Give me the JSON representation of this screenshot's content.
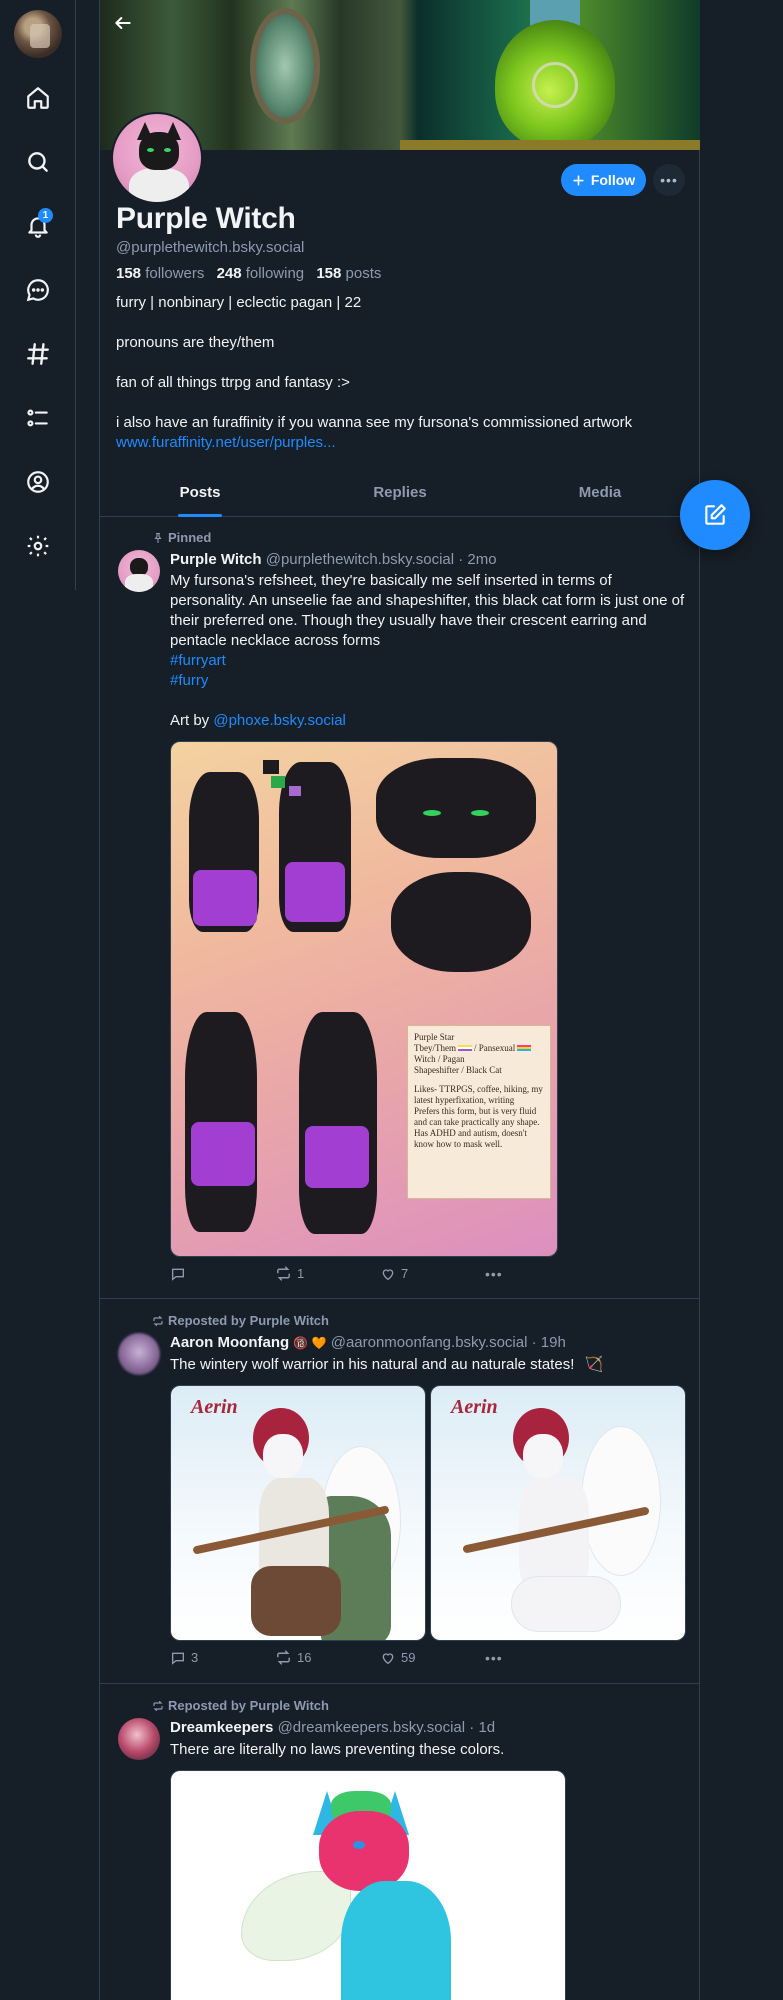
{
  "nav": {
    "items": [
      {
        "name": "home-icon"
      },
      {
        "name": "search-icon"
      },
      {
        "name": "notifications-icon",
        "badge": "1"
      },
      {
        "name": "chat-icon"
      },
      {
        "name": "feeds-icon"
      },
      {
        "name": "lists-icon"
      },
      {
        "name": "profile-icon"
      },
      {
        "name": "settings-icon"
      }
    ]
  },
  "profile": {
    "display_name": "Purple Witch",
    "handle": "@purplethewitch.bsky.social",
    "followers_count": "158",
    "followers_label": "followers",
    "following_count": "248",
    "following_label": "following",
    "posts_count": "158",
    "posts_label": "posts",
    "follow_label": "Follow",
    "bio": {
      "line1": "furry | nonbinary | eclectic pagan | 22",
      "line2": "pronouns are they/them",
      "line3": "fan of all things ttrpg and fantasy :>",
      "line4": "i also have an furaffinity if you wanna see my fursona's commissioned artwork",
      "link": "www.furaffinity.net/user/purples..."
    }
  },
  "tabs": [
    "Posts",
    "Replies",
    "Media"
  ],
  "posts": [
    {
      "context": "Pinned",
      "name": "Purple Witch",
      "handle": "@purplethewitch.bsky.social",
      "time": "· 2mo",
      "text": "My fursona's refsheet, they're basically me self inserted in terms of personality. An unseelie fae and shapeshifter, this black cat form is just one of their preferred one. Though they usually have their crescent earring and pentacle necklace across forms",
      "tag1": "#furryart",
      "tag2": "#furry",
      "art_prefix": "Art by",
      "art_mention": "@phoxe.bsky.social",
      "refcard": {
        "l1": "Purple Star",
        "l2": "Tbey/Them",
        "l2b": "/ Pansexual",
        "l3": "Witch / Pagan",
        "l4": "Shapeshifter / Black Cat",
        "l5": "Likes- TTRPGS, coffee, hiking, my latest hyperfixation, writing",
        "l6": "Prefers this form, but is very fluid and can take practically any shape.",
        "l7": "Has ADHD and autism, doesn't know how to mask well."
      },
      "replies": "",
      "reposts": "1",
      "likes": "7"
    },
    {
      "context": "Reposted by Purple Witch",
      "name": "Aaron Moonfang",
      "name_emoji": "🔞 🧡",
      "handle": "@aaronmoonfang.bsky.social",
      "time": "· 19h",
      "text": "The wintery wolf warrior in his natural and au naturale states!",
      "text_emoji": "🏹",
      "image_title": "Aerin",
      "replies": "3",
      "reposts": "16",
      "likes": "59"
    },
    {
      "context": "Reposted by Purple Witch",
      "name": "Dreamkeepers",
      "handle": "@dreamkeepers.bsky.social",
      "time": "· 1d",
      "text": "There are literally no laws preventing these colors."
    }
  ],
  "colors": {
    "background": "#161e27",
    "accent": "#208bfe",
    "muted": "#8d9aaf",
    "border": "#2e4052"
  }
}
